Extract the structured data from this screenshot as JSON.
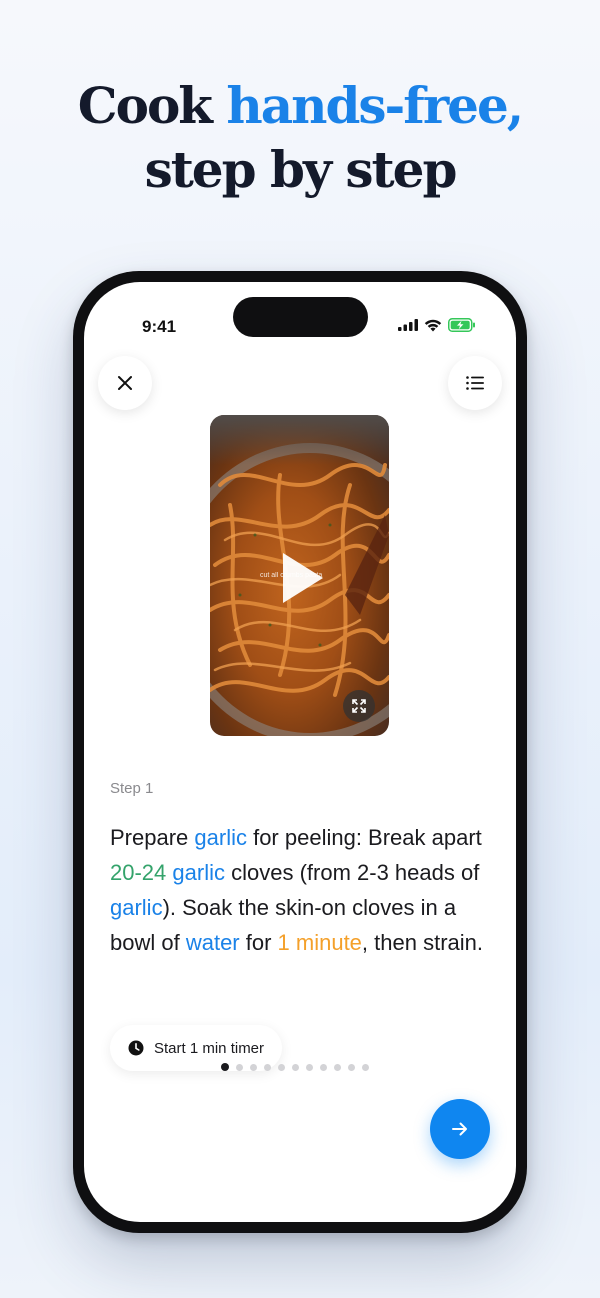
{
  "headline": {
    "prefix": "Cook ",
    "accent": "hands-free,",
    "line2": "step by step",
    "accent_color": "#1a82e8"
  },
  "status_bar": {
    "time": "9:41",
    "icons": [
      "cellular-signal-icon",
      "wifi-icon",
      "battery-charging-icon"
    ]
  },
  "toolbar": {
    "close_icon": "close-icon",
    "steps_icon": "list-icon"
  },
  "video": {
    "caption": "cut all crumbs pasta",
    "play_icon": "play-icon",
    "fullscreen_icon": "expand-icon"
  },
  "step": {
    "label": "Step 1",
    "instruction": [
      {
        "text": "Prepare ",
        "style": "plain"
      },
      {
        "text": "garlic",
        "style": "ingredient"
      },
      {
        "text": " for peeling: Break apart ",
        "style": "plain"
      },
      {
        "text": "20-24",
        "style": "quantity"
      },
      {
        "text": " ",
        "style": "plain"
      },
      {
        "text": "garlic",
        "style": "ingredient"
      },
      {
        "text": " cloves (from 2-3 heads of ",
        "style": "plain"
      },
      {
        "text": "garlic",
        "style": "ingredient"
      },
      {
        "text": "). Soak the skin-on cloves in a bowl of ",
        "style": "plain"
      },
      {
        "text": "water",
        "style": "ingredient"
      },
      {
        "text": " for ",
        "style": "plain"
      },
      {
        "text": "1 minute",
        "style": "time"
      },
      {
        "text": ", then strain.",
        "style": "plain"
      }
    ],
    "colors": {
      "ingredient": "#1a82e8",
      "quantity": "#34a36b",
      "time": "#f4a02a"
    }
  },
  "timer": {
    "label": "Start 1 min timer",
    "icon": "clock-icon"
  },
  "pagination": {
    "total": 11,
    "current": 1
  },
  "next_button": {
    "icon": "arrow-right-icon",
    "color": "#0f86f0"
  }
}
